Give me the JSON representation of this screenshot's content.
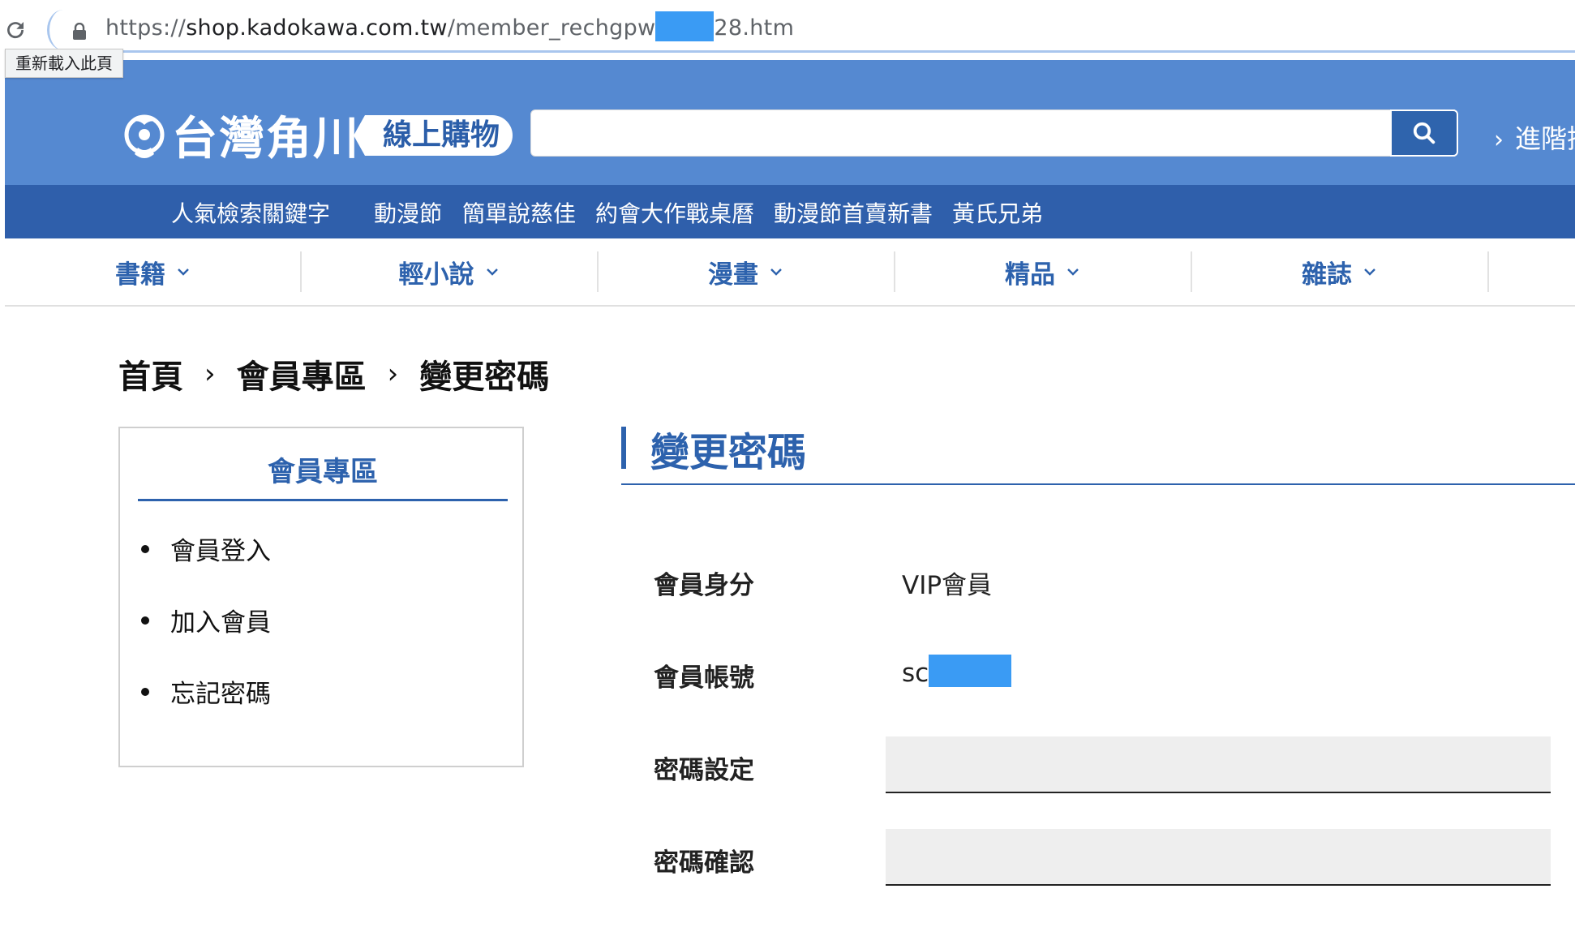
{
  "browser": {
    "url_prefix": "https://",
    "url_host": "shop.kadokawa.com.tw",
    "url_path_start": "/member_rechgpw",
    "url_path_end": "28",
    "url_ext": ".htm",
    "reload_tooltip": "重新載入此頁"
  },
  "header": {
    "logo_text": "台灣角川",
    "logo_sub": "線上購物",
    "advanced_label": "進階搜"
  },
  "keywords": {
    "label": "人氣檢索關鍵字",
    "items": [
      "動漫節",
      "簡單說慈佳",
      "約會大作戰桌曆",
      "動漫節首賣新書",
      "黃氏兄弟"
    ]
  },
  "categories": [
    "書籍",
    "輕小說",
    "漫畫",
    "精品",
    "雜誌"
  ],
  "breadcrumb": [
    "首頁",
    "會員專區",
    "變更密碼"
  ],
  "sidebar": {
    "title": "會員專區",
    "items": [
      "會員登入",
      "加入會員",
      "忘記密碼"
    ]
  },
  "main": {
    "title": "變更密碼",
    "rows": [
      {
        "label": "會員身分",
        "value": "VIP會員"
      },
      {
        "label": "會員帳號",
        "value": "sc"
      },
      {
        "label": "密碼設定"
      },
      {
        "label": "密碼確認"
      }
    ]
  },
  "colors": {
    "header_blue": "#5589d1",
    "nav_blue": "#2f5fab",
    "accent_blue": "#2d62ad",
    "redaction": "#3a9bf4"
  }
}
